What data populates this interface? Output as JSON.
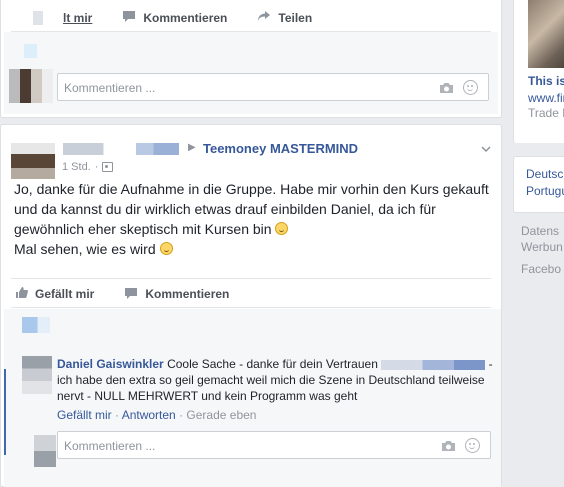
{
  "top_card": {
    "like_label": "lt mir",
    "comment_label": "Kommentieren",
    "share_label": "Teilen",
    "comment_placeholder": "Kommentieren ..."
  },
  "post": {
    "group_name": "Teemoney MASTERMIND",
    "time": "1 Std.",
    "text_line1": "Jo, danke für die Aufnahme in die Gruppe. Habe mir vorhin den Kurs gekauft und da kannst du dir wirklich etwas drauf einbilden Daniel, da ich für gewöhnlich eher skeptisch mit Kursen bin",
    "text_line2": "Mal sehen, wie es wird",
    "like_label": "Gefällt mir",
    "comment_label": "Kommentieren"
  },
  "comment": {
    "author": "Daniel Gaiswinkler",
    "text_a": "Coole Sache - danke für dein Vertrauen",
    "text_b": "- ich habe den extra so geil gemacht weil mich die Szene in Deutschland teilweise nervt - NULL MEHRWERT und kein Programm was geht",
    "like": "Gefällt mir",
    "reply": "Antworten",
    "time": "Gerade eben",
    "reply_placeholder": "Kommentieren ..."
  },
  "right": {
    "ad_title": "This is",
    "ad_url": "www.fir",
    "ad_sub": "Trade E",
    "lang1": "Deutsc",
    "lang2": "Portugu",
    "footer1": "Datens",
    "footer2": "Werbun",
    "footer3": "Facebo"
  },
  "colors": {
    "link": "#365899",
    "accent": "#4267b2",
    "muted": "#90949c",
    "background": "#e9ebee"
  }
}
